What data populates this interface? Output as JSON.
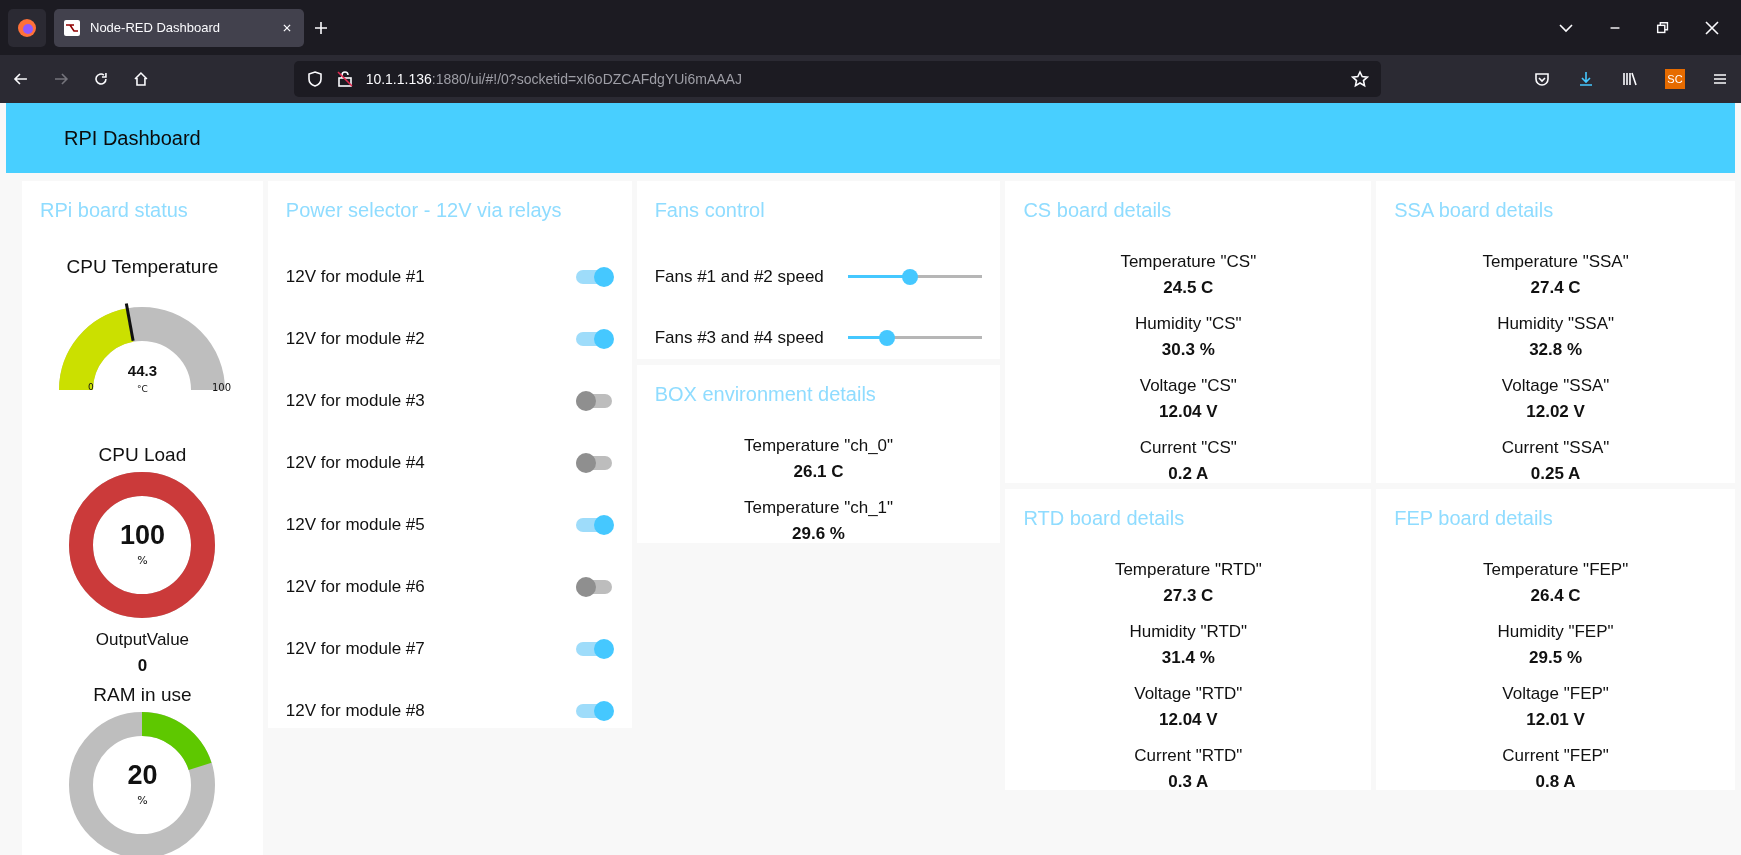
{
  "browser": {
    "tab_title": "Node-RED Dashboard",
    "url_host": "10.1.1.136",
    "url_rest": ":1880/ui/#!/0?socketid=xI6oDZCAFdgYUi6mAAAJ",
    "account_badge": "SC"
  },
  "header": {
    "title": "RPI Dashboard"
  },
  "rpi_card": {
    "title": "RPi board status",
    "widgets": [
      {
        "kind": "gauge",
        "label": "CPU Temperature",
        "value": "44.3",
        "unit": "°C",
        "min": "0",
        "max": "100",
        "color": "#cbe000"
      },
      {
        "kind": "donut",
        "label": "CPU Load",
        "value": "100",
        "unit": "%",
        "level": 1,
        "color": "#cb3a3a"
      },
      {
        "kind": "text",
        "label": "OutputValue",
        "value": "0"
      },
      {
        "kind": "donut",
        "label": "RAM in use",
        "value": "20",
        "unit": "%",
        "level": 0.2,
        "color": "#5ec800"
      }
    ]
  },
  "power_card": {
    "title": "Power selector - 12V via relays",
    "switches": [
      {
        "label": "12V for module #1",
        "on": true
      },
      {
        "label": "12V for module #2",
        "on": true
      },
      {
        "label": "12V for module #3",
        "on": false
      },
      {
        "label": "12V for module #4",
        "on": false
      },
      {
        "label": "12V for module #5",
        "on": true
      },
      {
        "label": "12V for module #6",
        "on": false
      },
      {
        "label": "12V for module #7",
        "on": true
      },
      {
        "label": "12V for module #8",
        "on": true
      }
    ]
  },
  "fans_card": {
    "title": "Fans control",
    "sliders": [
      {
        "label": "Fans #1 and #2 speed",
        "level": 0.46
      },
      {
        "label": "Fans #3 and #4 speed",
        "level": 0.29
      }
    ]
  },
  "box_card": {
    "title": "BOX environment details",
    "rows": [
      {
        "label": "Temperature \"ch_0\"",
        "value": "26.1 C"
      },
      {
        "label": "Temperature \"ch_1\"",
        "value": "29.6 %"
      }
    ]
  },
  "detail_cards": [
    {
      "title": "CS board details",
      "rows": [
        {
          "label": "Temperature \"CS\"",
          "value": "24.5 C"
        },
        {
          "label": "Humidity \"CS\"",
          "value": "30.3 %"
        },
        {
          "label": "Voltage \"CS\"",
          "value": "12.04 V"
        },
        {
          "label": "Current \"CS\"",
          "value": "0.2 A"
        }
      ]
    },
    {
      "title": "SSA board details",
      "rows": [
        {
          "label": "Temperature \"SSA\"",
          "value": "27.4 C"
        },
        {
          "label": "Humidity \"SSA\"",
          "value": "32.8 %"
        },
        {
          "label": "Voltage \"SSA\"",
          "value": "12.02 V"
        },
        {
          "label": "Current \"SSA\"",
          "value": "0.25 A"
        }
      ]
    },
    {
      "title": "RTD board details",
      "rows": [
        {
          "label": "Temperature \"RTD\"",
          "value": "27.3 C"
        },
        {
          "label": "Humidity \"RTD\"",
          "value": "31.4 %"
        },
        {
          "label": "Voltage \"RTD\"",
          "value": "12.04 V"
        },
        {
          "label": "Current \"RTD\"",
          "value": "0.3 A"
        }
      ]
    },
    {
      "title": "FEP board details",
      "rows": [
        {
          "label": "Temperature \"FEP\"",
          "value": "26.4 C"
        },
        {
          "label": "Humidity \"FEP\"",
          "value": "29.5 %"
        },
        {
          "label": "Voltage \"FEP\"",
          "value": "12.01 V"
        },
        {
          "label": "Current \"FEP\"",
          "value": "0.8 A"
        }
      ]
    }
  ]
}
